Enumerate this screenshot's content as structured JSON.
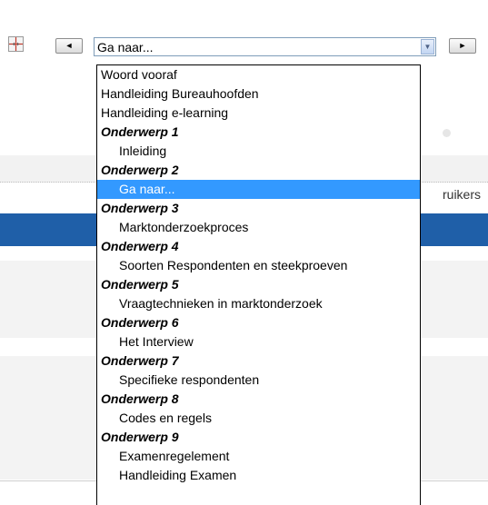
{
  "background": {
    "right_text": "ruikers"
  },
  "toolbar": {
    "nav_icon": "page-nav-icon",
    "prev_icon": "arrow-left-icon",
    "next_icon": "arrow-right-icon",
    "prev_glyph": "◄",
    "next_glyph": "►",
    "select_value": "Ga naar...",
    "select_arrow_glyph": "▼"
  },
  "dropdown": {
    "options": [
      {
        "label": "Woord vooraf",
        "kind": "option"
      },
      {
        "label": "Handleiding Bureauhoofden",
        "kind": "option"
      },
      {
        "label": "Handleiding e-learning",
        "kind": "option"
      },
      {
        "label": "Onderwerp 1",
        "kind": "group"
      },
      {
        "label": "Inleiding",
        "kind": "child"
      },
      {
        "label": "Onderwerp 2",
        "kind": "group"
      },
      {
        "label": "Ga naar...",
        "kind": "child",
        "selected": true
      },
      {
        "label": "Onderwerp 3",
        "kind": "group"
      },
      {
        "label": "Marktonderzoekproces",
        "kind": "child"
      },
      {
        "label": "Onderwerp 4",
        "kind": "group"
      },
      {
        "label": "Soorten Respondenten en steekproeven",
        "kind": "child"
      },
      {
        "label": "Onderwerp 5",
        "kind": "group"
      },
      {
        "label": "Vraagtechnieken in marktonderzoek",
        "kind": "child"
      },
      {
        "label": "Onderwerp 6",
        "kind": "group"
      },
      {
        "label": "Het Interview",
        "kind": "child"
      },
      {
        "label": "Onderwerp 7",
        "kind": "group"
      },
      {
        "label": "Specifieke respondenten",
        "kind": "child"
      },
      {
        "label": "Onderwerp 8",
        "kind": "group"
      },
      {
        "label": "Codes en regels",
        "kind": "child"
      },
      {
        "label": "Onderwerp 9",
        "kind": "group"
      },
      {
        "label": "Examenregelement",
        "kind": "child"
      },
      {
        "label": "Handleiding Examen",
        "kind": "child"
      }
    ]
  },
  "colors": {
    "selection": "#3399ff",
    "header_band": "#1f5fa8"
  }
}
